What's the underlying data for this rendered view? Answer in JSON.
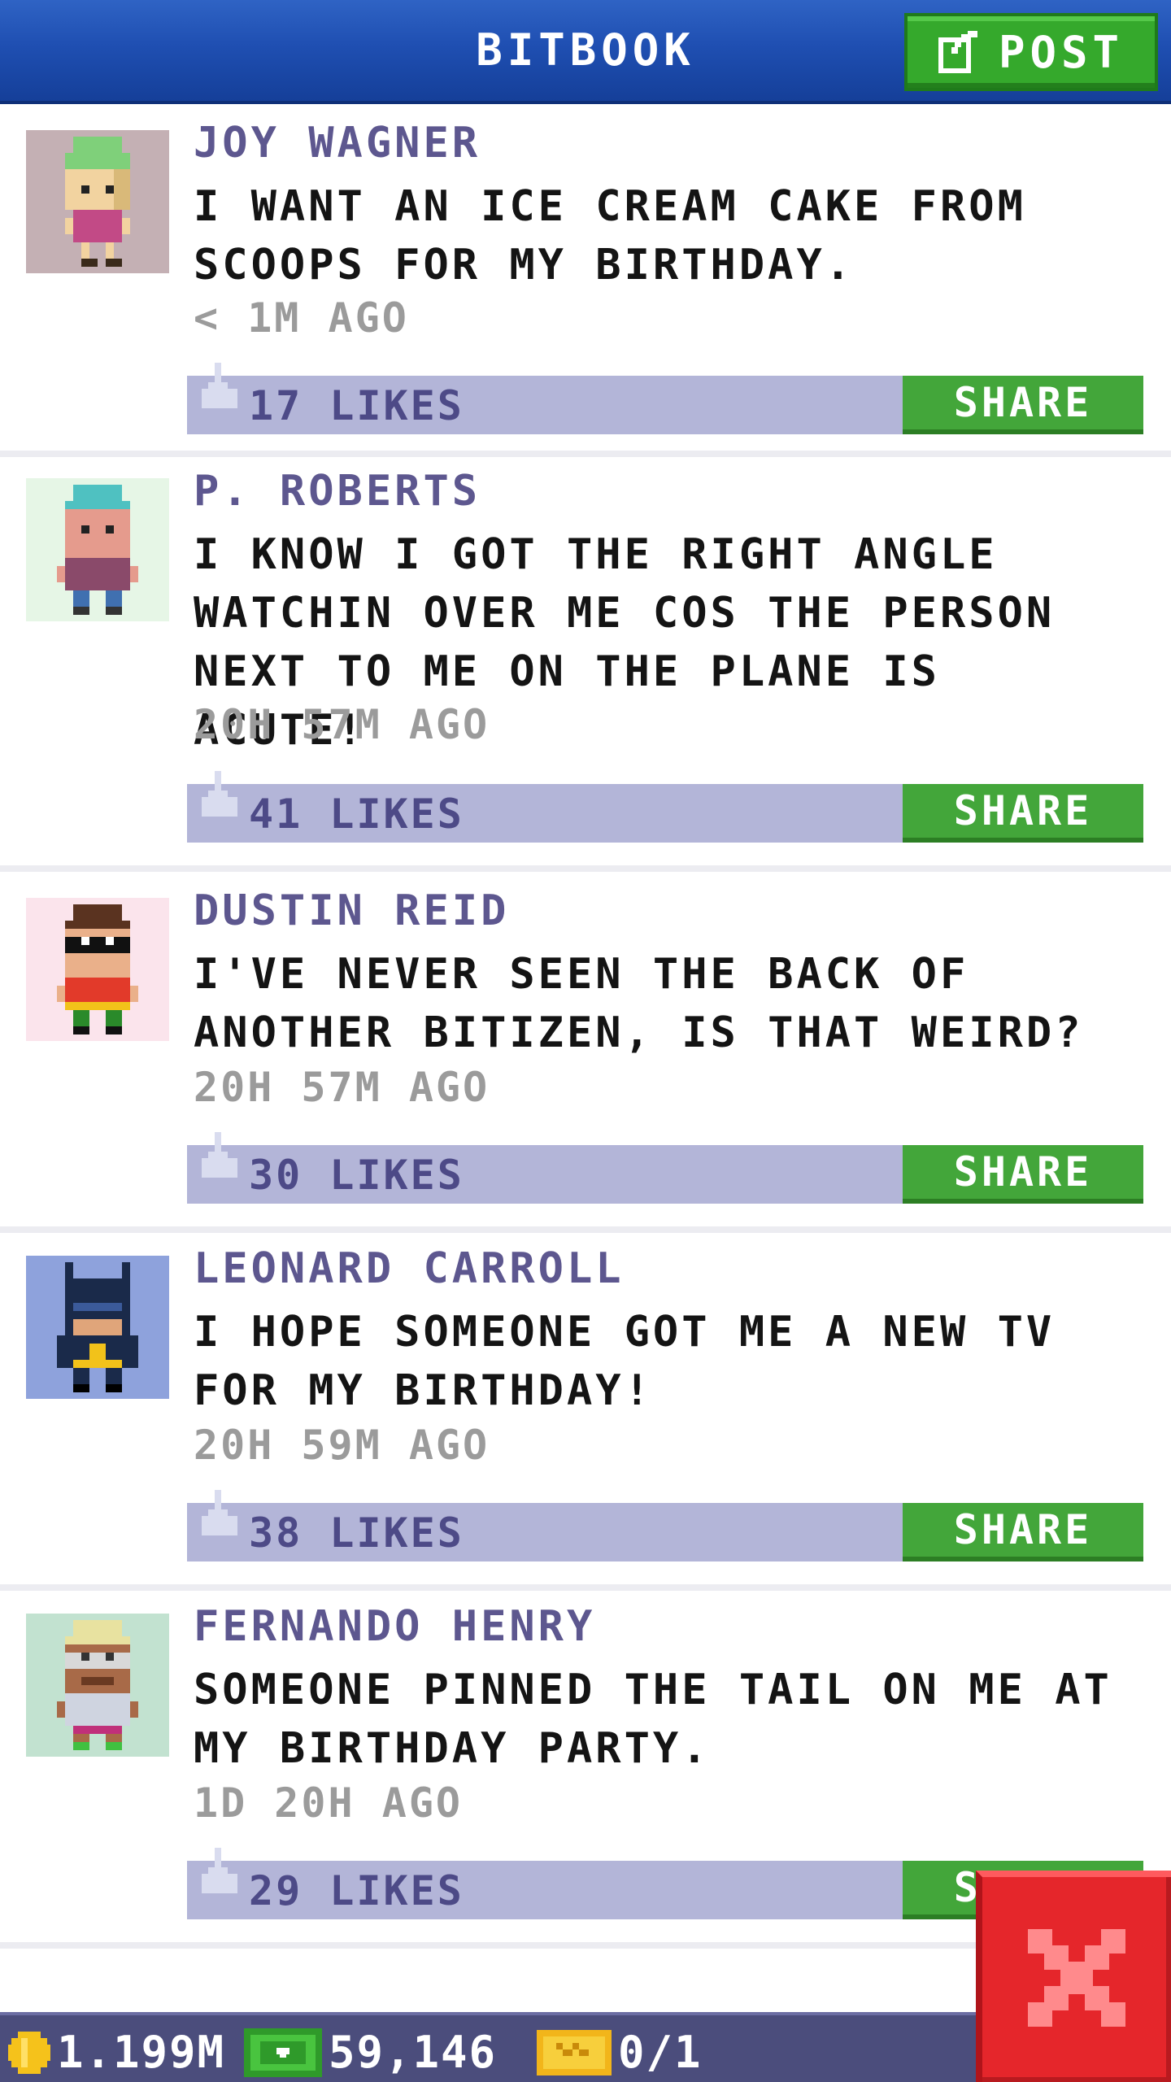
{
  "header": {
    "title": "BITBOOK",
    "post_label": "POST"
  },
  "colors": {
    "header_blue": "#1f4fb2",
    "post_green": "#35a92c",
    "like_bar": "#b3b5d8",
    "name_purple": "#5d578f",
    "close_red": "#e5262b"
  },
  "posts": [
    {
      "author": "JOY WAGNER",
      "lines": [
        "I WANT AN ICE CREAM CAKE FROM",
        "SCOOPS FOR MY BIRTHDAY."
      ],
      "time": "< 1M AGO",
      "likes": "17 LIKES",
      "share": "SHARE",
      "avatar_bg": "#c4b0b4"
    },
    {
      "author": "P. ROBERTS",
      "lines": [
        "I KNOW I GOT THE RIGHT ANGLE",
        "WATCHIN OVER ME COS THE PERSON",
        "NEXT TO ME ON THE PLANE IS ACUTE!"
      ],
      "time": "20H 57M AGO",
      "likes": "41 LIKES",
      "share": "SHARE",
      "avatar_bg": "#e6f6e6"
    },
    {
      "author": "DUSTIN REID",
      "lines": [
        "I'VE NEVER SEEN THE BACK OF",
        "ANOTHER BITIZEN, IS THAT WEIRD?"
      ],
      "time": "20H 57M AGO",
      "likes": "30 LIKES",
      "share": "SHARE",
      "avatar_bg": "#fbe4ec"
    },
    {
      "author": "LEONARD CARROLL",
      "lines": [
        "I HOPE SOMEONE GOT ME A NEW TV",
        "FOR MY BIRTHDAY!"
      ],
      "time": "20H 59M AGO",
      "likes": "38 LIKES",
      "share": "SHARE",
      "avatar_bg": "#8ea2dc"
    },
    {
      "author": "FERNANDO HENRY",
      "lines": [
        "SOMEONE PINNED THE TAIL ON ME AT",
        "MY BIRTHDAY PARTY."
      ],
      "time": "1D 20H AGO",
      "likes": "29 LIKES",
      "share": "SHARE",
      "avatar_bg": "#c2e2d0"
    }
  ],
  "status": {
    "coins": "1.199M",
    "bux": "59,146",
    "tickets": "0/1"
  }
}
